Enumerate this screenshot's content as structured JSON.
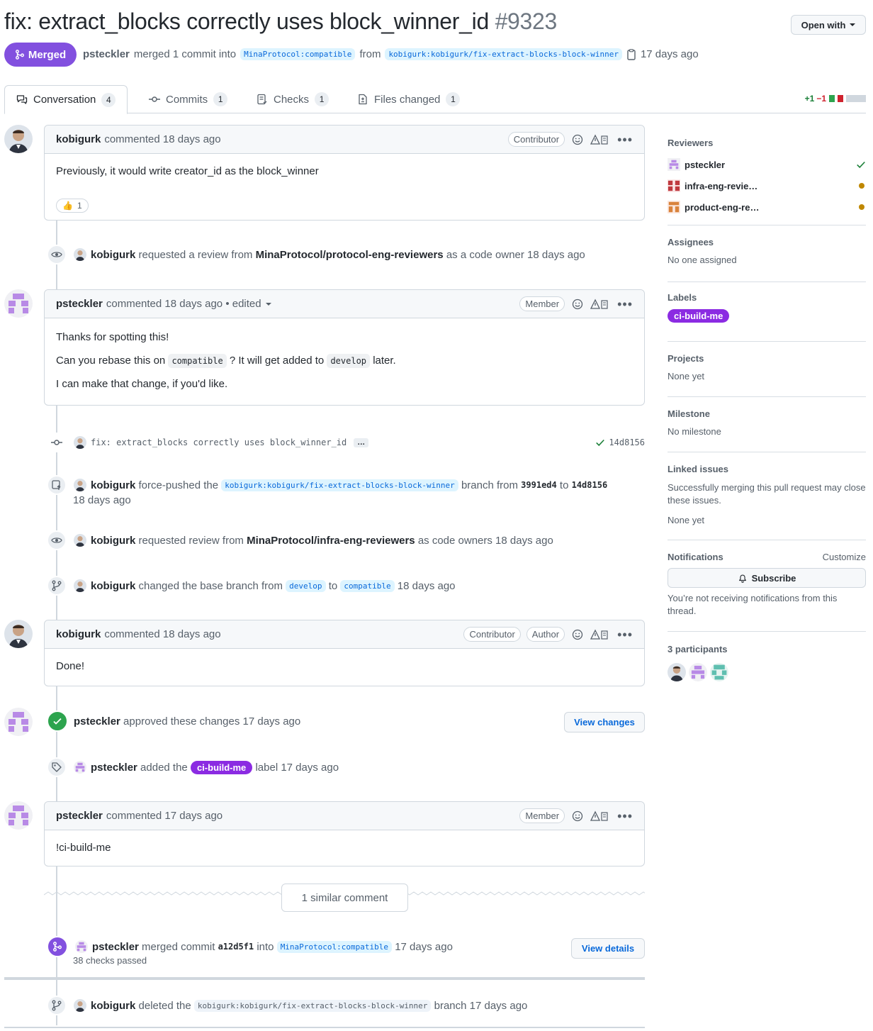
{
  "header": {
    "title": "fix: extract_blocks correctly uses block_winner_id",
    "number": "#9323",
    "open_with": "Open with",
    "status": "Merged",
    "meta_user": "psteckler",
    "meta_merged": "merged 1 commit into",
    "base_branch": "MinaProtocol:compatible",
    "from": "from",
    "head_branch": "kobigurk:kobigurk/fix-extract-blocks-block-winner",
    "meta_time": "17 days ago"
  },
  "tabs": [
    {
      "label": "Conversation",
      "count": "4"
    },
    {
      "label": "Commits",
      "count": "1"
    },
    {
      "label": "Checks",
      "count": "1"
    },
    {
      "label": "Files changed",
      "count": "1"
    }
  ],
  "diffstat": {
    "add": "+1",
    "del": "−1"
  },
  "timeline": {
    "c1": {
      "author": "kobigurk",
      "action": "commented 18 days ago",
      "role": "Contributor",
      "body": "Previously, it would write creator_id as the block_winner",
      "reaction_emoji": "👍",
      "reaction_count": "1"
    },
    "e1": {
      "user": "kobigurk",
      "pre": "requested a review from",
      "target": "MinaProtocol/protocol-eng-reviewers",
      "post": "as a code owner 18 days ago"
    },
    "c2": {
      "author": "psteckler",
      "action": "commented 18 days ago",
      "edited": "• edited",
      "role": "Member",
      "p1": "Thanks for spotting this!",
      "p2a": "Can you rebase this on",
      "p2code1": "compatible",
      "p2b": "? It will get added to",
      "p2code2": "develop",
      "p2c": "later.",
      "p3": "I can make that change, if you'd like."
    },
    "commit": {
      "message": "fix: extract_blocks correctly uses block_winner_id",
      "ellipsis": "…",
      "sha": "14d8156"
    },
    "e2": {
      "user": "kobigurk",
      "pre": "force-pushed the",
      "branch": "kobigurk:kobigurk/fix-extract-blocks-block-winner",
      "mid": "branch from",
      "from_sha": "3991ed4",
      "to": "to",
      "to_sha": "14d8156",
      "time": "18 days ago"
    },
    "e3": {
      "user": "kobigurk",
      "pre": "requested review from",
      "target": "MinaProtocol/infra-eng-reviewers",
      "post": "as code owners 18 days ago"
    },
    "e4": {
      "user": "kobigurk",
      "pre": "changed the base branch from",
      "from": "develop",
      "to": "to",
      "to_branch": "compatible",
      "time": "18 days ago"
    },
    "c3": {
      "author": "kobigurk",
      "action": "commented 18 days ago",
      "role1": "Contributor",
      "role2": "Author",
      "body": "Done!"
    },
    "approve": {
      "user": "psteckler",
      "text": "approved these changes 17 days ago",
      "button": "View changes"
    },
    "e5": {
      "user": "psteckler",
      "pre": "added the",
      "label": "ci-build-me",
      "post": "label 17 days ago"
    },
    "c4": {
      "author": "psteckler",
      "action": "commented 17 days ago",
      "role": "Member",
      "body": "!ci-build-me"
    },
    "similar": "1 similar comment",
    "merge": {
      "user": "psteckler",
      "pre": "merged commit",
      "sha": "a12d5f1",
      "into": "into",
      "branch": "MinaProtocol:compatible",
      "time": "17 days ago",
      "checks": "38 checks passed",
      "button": "View details"
    },
    "e6": {
      "user": "kobigurk",
      "pre": "deleted the",
      "branch": "kobigurk:kobigurk/fix-extract-blocks-block-winner",
      "post": "branch 17 days ago"
    }
  },
  "sidebar": {
    "reviewers": {
      "heading": "Reviewers",
      "items": [
        "psteckler",
        "infra-eng-revie…",
        "product-eng-re…"
      ]
    },
    "assignees": {
      "heading": "Assignees",
      "value": "No one assigned"
    },
    "labels": {
      "heading": "Labels",
      "value": "ci-build-me"
    },
    "projects": {
      "heading": "Projects",
      "value": "None yet"
    },
    "milestone": {
      "heading": "Milestone",
      "value": "No milestone"
    },
    "linked": {
      "heading": "Linked issues",
      "desc": "Successfully merging this pull request may close these issues.",
      "value": "None yet"
    },
    "notifications": {
      "heading": "Notifications",
      "customize": "Customize",
      "subscribe": "Subscribe",
      "desc": "You’re not receiving notifications from this thread."
    },
    "participants": {
      "heading": "3 participants"
    }
  },
  "colors": {
    "merged": "#8250df",
    "label": "#8b2be2",
    "link": "#0969da",
    "success": "#2da44e"
  }
}
